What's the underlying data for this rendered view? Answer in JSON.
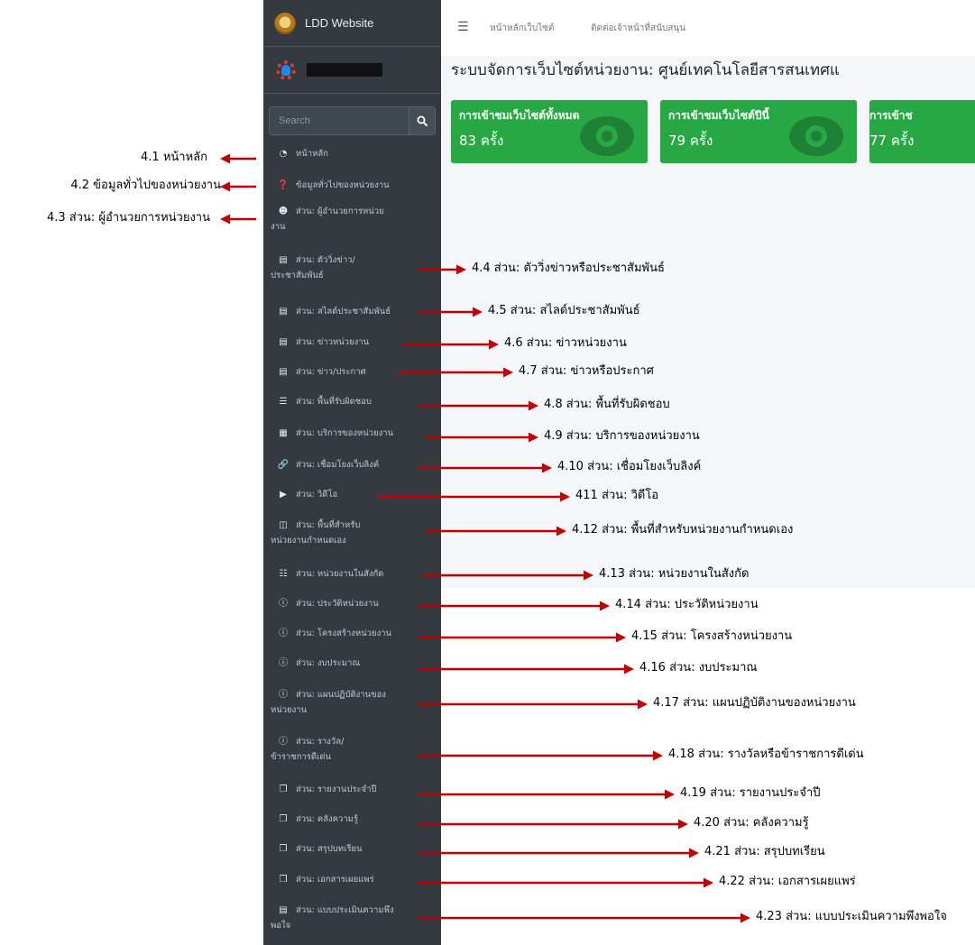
{
  "sidebar": {
    "brand": "LDD Website",
    "search_placeholder": "Search",
    "items": [
      {
        "label": "หน้าหลัก",
        "icon": "dashboard-icon"
      },
      {
        "label": "ข้อมูลทั่วไปของหน่วยงาน",
        "icon": "question-circle-icon"
      },
      {
        "label": "ส่วน: ผู้อำนวยการหน่วยงาน",
        "icon": "user-tie-icon"
      },
      {
        "label": "ส่วน: ตัววิ่งข่าว/ประชาสัมพันธ์",
        "icon": "newspaper-icon"
      },
      {
        "label": "ส่วน: สไลด์ประชาสัมพันธ์",
        "icon": "newspaper-icon"
      },
      {
        "label": "ส่วน: ข่าวหน่วยงาน",
        "icon": "newspaper-icon"
      },
      {
        "label": "ส่วน: ข่าว/ประกาศ",
        "icon": "newspaper-icon"
      },
      {
        "label": "ส่วน: พื้นที่รับผิดชอบ",
        "icon": "bars-icon"
      },
      {
        "label": "ส่วน: บริการของหน่วยงาน",
        "icon": "grid-icon"
      },
      {
        "label": "ส่วน: เชื่อมโยงเว็บลิงค์",
        "icon": "link-icon"
      },
      {
        "label": "ส่วน: วิดีโอ",
        "icon": "play-circle-icon"
      },
      {
        "label": "ส่วน: พื้นที่สำหรับหน่วยงานกำหนดเอง",
        "icon": "laptop-icon"
      },
      {
        "label": "ส่วน: หน่วยงานในสังกัด",
        "icon": "sitemap-icon"
      },
      {
        "label": "ส่วน: ประวัติหน่วยงาน",
        "icon": "info-circle-icon"
      },
      {
        "label": "ส่วน: โครงสร้างหน่วยงาน",
        "icon": "info-circle-icon"
      },
      {
        "label": "ส่วน: งบประมาณ",
        "icon": "info-circle-icon"
      },
      {
        "label": "ส่วน: แผนปฏิบัติงานของหน่วยงาน",
        "icon": "info-circle-icon"
      },
      {
        "label": "ส่วน: รางวัล/ข้าราชการดีเด่น",
        "icon": "info-circle-icon"
      },
      {
        "label": "ส่วน: รายงานประจำปี",
        "icon": "copy-icon"
      },
      {
        "label": "ส่วน: คลังความรู้",
        "icon": "copy-icon"
      },
      {
        "label": "ส่วน: สรุปบทเรียน",
        "icon": "copy-icon"
      },
      {
        "label": "ส่วน: เอกสารเผยแพร่",
        "icon": "copy-icon"
      },
      {
        "label": "ส่วน: แบบประเมินความพึงพอใจ",
        "icon": "form-icon"
      }
    ]
  },
  "topnav": {
    "links": [
      "หน้าหลักเว็บไซต์",
      "ติดต่อเจ้าหน้าที่สนับสนุน"
    ]
  },
  "main": {
    "title": "ระบบจัดการเว็บไซต์หน่วยงาน: ศูนย์เทคโนโลยีสารสนเทศแ",
    "boxes": [
      {
        "label": "การเข้าชมเว็บไซต์ทั้งหมด",
        "value": "83 ครั้ง"
      },
      {
        "label": "การเข้าชมเว็บไซต์ปีนี้",
        "value": "79 ครั้ง"
      },
      {
        "label": "การเข้าช",
        "value": "77 ครั้ง"
      }
    ],
    "box_color": "#28a745"
  },
  "annotations": {
    "left": [
      "4.1 หน้าหลัก",
      "4.2 ข้อมูลทั่วไปของหน่วยงาน",
      "4.3 ส่วน: ผู้อำนวยการหน่วยงาน"
    ],
    "right": [
      "4.4 ส่วน: ตัววิ่งข่าวหรือประชาสัมพันธ์",
      "4.5 ส่วน: สไลด์ประชาสัมพันธ์",
      "4.6 ส่วน: ข่าวหน่วยงาน",
      "4.7 ส่วน: ข่าวหรือประกาศ",
      "4.8 ส่วน: พื้นที่รับผิดชอบ",
      "4.9 ส่วน: บริการของหน่วยงาน",
      "4.10 ส่วน: เชื่อมโยงเว็บลิงค์",
      "411 ส่วน: วิดีโอ",
      "4.12 ส่วน: พื้นที่สำหรับหน่วยงานกำหนดเอง",
      "4.13 ส่วน: หน่วยงานในสังกัด",
      "4.14 ส่วน: ประวัติหน่วยงาน",
      "4.15 ส่วน: โครงสร้างหน่วยงาน",
      "4.16 ส่วน: งบประมาณ",
      "4.17 ส่วน: แผนปฏิบัติงานของหน่วยงาน",
      "4.18 ส่วน: รางวัลหรือข้าราชการดีเด่น",
      "4.19 ส่วน: รายงานประจำปี",
      "4.20 ส่วน: คลังความรู้",
      "4.21 ส่วน: สรุปบทเรียน",
      "4.22 ส่วน: เอกสารเผยแพร่",
      "4.23 ส่วน: แบบประเมินความพึงพอใจ"
    ],
    "arrow_color": "#c00000"
  }
}
